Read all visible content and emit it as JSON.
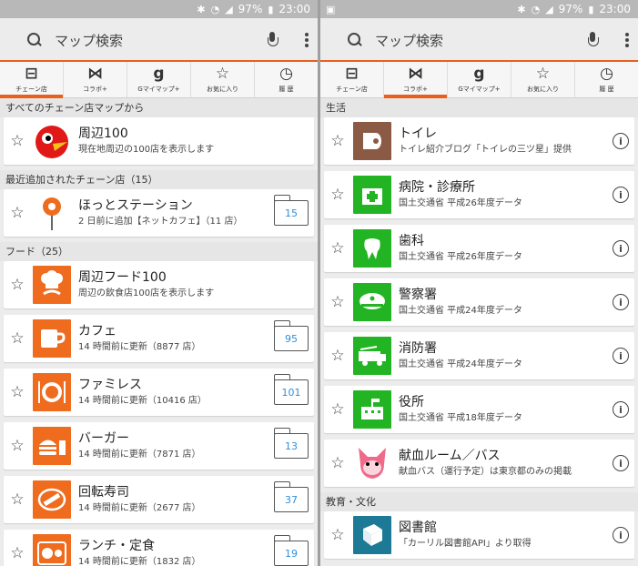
{
  "status": {
    "battery": "97%",
    "time": "23:00"
  },
  "search": {
    "placeholder": "マップ検索"
  },
  "tabs": [
    {
      "label": "チェーン店",
      "icon": "chain-store-icon"
    },
    {
      "label": "コラボ+",
      "icon": "handshake-icon"
    },
    {
      "label": "Gマイマップ+",
      "icon": "g-mymap-icon"
    },
    {
      "label": "お気に入り",
      "icon": "star-icon"
    },
    {
      "label": "履 歴",
      "icon": "history-icon"
    }
  ],
  "left": {
    "sections": {
      "all": "すべてのチェーン店マップから",
      "recent": "最近追加されたチェーン店（15）",
      "food": "フード（25）"
    },
    "items": [
      {
        "title": "周辺100",
        "sub": "現在地周辺の100店を表示します"
      },
      {
        "title": "ほっとステーション",
        "sub": "2 日前に追加【ネットカフェ】（11 店）",
        "count": "15"
      },
      {
        "title": "周辺フード100",
        "sub": "周辺の飲食店100店を表示します"
      },
      {
        "title": "カフェ",
        "sub": "14 時間前に更新（8877 店）",
        "count": "95"
      },
      {
        "title": "ファミレス",
        "sub": "14 時間前に更新（10416 店）",
        "count": "101"
      },
      {
        "title": "バーガー",
        "sub": "14 時間前に更新（7871 店）",
        "count": "13"
      },
      {
        "title": "回転寿司",
        "sub": "14 時間前に更新（2677 店）",
        "count": "37"
      },
      {
        "title": "ランチ・定食",
        "sub": "14 時間前に更新（1832 店）",
        "count": "19"
      }
    ]
  },
  "right": {
    "sections": {
      "life": "生活",
      "edu": "教育・文化"
    },
    "items": [
      {
        "title": "トイレ",
        "sub": "トイレ紹介ブログ「トイレの三ツ星」提供"
      },
      {
        "title": "病院・診療所",
        "sub": "国土交通省 平成26年度データ"
      },
      {
        "title": "歯科",
        "sub": "国土交通省 平成26年度データ"
      },
      {
        "title": "警察署",
        "sub": "国土交通省 平成24年度データ"
      },
      {
        "title": "消防署",
        "sub": "国土交通省 平成24年度データ"
      },
      {
        "title": "役所",
        "sub": "国土交通省 平成18年度データ"
      },
      {
        "title": "献血ルーム／バス",
        "sub": "献血バス（運行予定）は東京都のみの掲載"
      },
      {
        "title": "図書館",
        "sub": "「カーリル図書館API」より取得"
      }
    ]
  },
  "colors": {
    "accent": "#e8601c",
    "folder_count": "#2f8fd8",
    "category_orange": "#ef6b1e",
    "category_green": "#22b422"
  }
}
